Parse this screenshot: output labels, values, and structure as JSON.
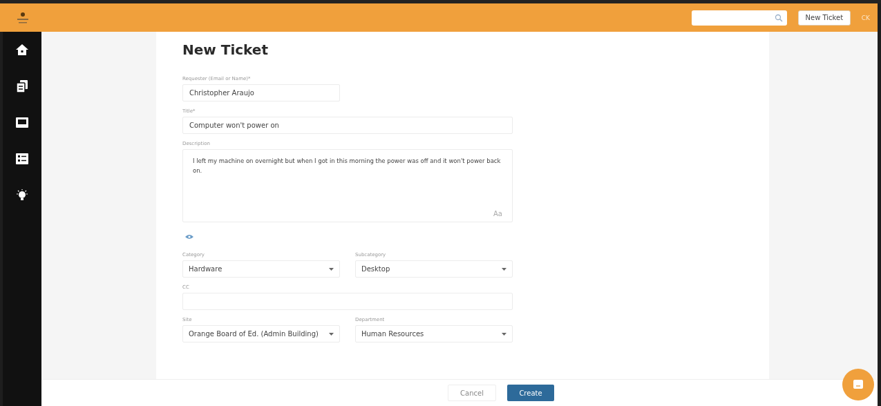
{
  "header": {
    "new_ticket_button": "New Ticket",
    "avatar_initials": "CK"
  },
  "page": {
    "title": "New Ticket",
    "rows": [
      [
        {
          "kind": "text",
          "label": "Requester (Email or Name)*",
          "value": "Christopher Araujo",
          "narrow": true
        }
      ],
      [
        {
          "kind": "text",
          "label": "Title*",
          "value": "Computer won't power on"
        }
      ],
      [
        {
          "kind": "textarea",
          "label": "Description",
          "value": "I left my machine on overnight but when I got in this morning the power was off and it won't power back on.",
          "corner": "Aa"
        }
      ],
      [
        {
          "kind": "eye"
        }
      ],
      [
        {
          "kind": "select",
          "label": "Category",
          "value": "Hardware"
        },
        {
          "kind": "select",
          "label": "Subcategory",
          "value": "Desktop"
        }
      ],
      [
        {
          "kind": "text",
          "label": "CC"
        }
      ],
      [
        {
          "kind": "select",
          "label": "Site",
          "value": "Orange Board of Ed. (Admin Building)"
        },
        {
          "kind": "select",
          "label": "Department",
          "value": "Human Resources"
        }
      ]
    ]
  },
  "footer": {
    "buttons": [
      {
        "label": "Cancel",
        "kind": "secondary"
      },
      {
        "label": "Create",
        "kind": "primary"
      }
    ]
  }
}
